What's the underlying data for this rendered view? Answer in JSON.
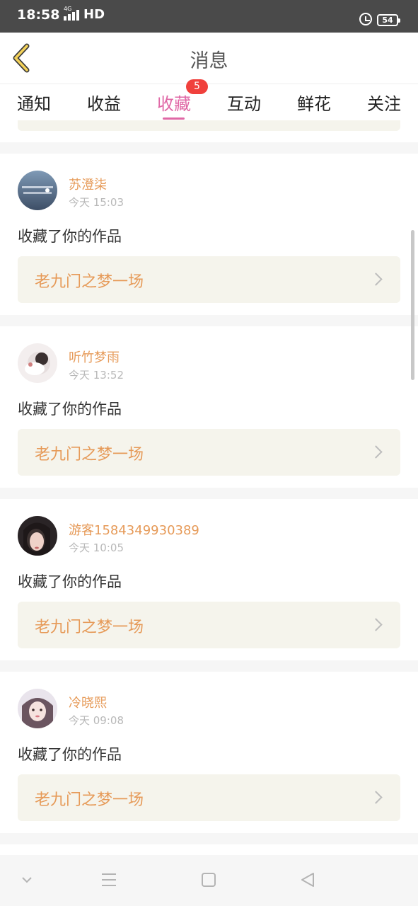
{
  "status_bar": {
    "time": "18:58",
    "network": "4G",
    "hd": "HD",
    "battery": "54"
  },
  "header": {
    "title": "消息",
    "back_icon": "chevron-left-icon"
  },
  "tabs": {
    "items": [
      {
        "label": "通知"
      },
      {
        "label": "收益"
      },
      {
        "label": "收藏",
        "active": true
      },
      {
        "label": "互动"
      },
      {
        "label": "鲜花"
      },
      {
        "label": "关注"
      }
    ],
    "badge": "5",
    "active_color": "#e068a6",
    "badge_color": "#f0403c"
  },
  "feed": {
    "items": [
      {
        "username": "苏澄柒",
        "time": "今天 15:03",
        "action": "收藏了你的作品",
        "work_title": "老九门之梦一场"
      },
      {
        "username": "听竹梦雨",
        "time": "今天 13:52",
        "action": "收藏了你的作品",
        "work_title": "老九门之梦一场"
      },
      {
        "username": "游客1584349930389",
        "time": "今天 10:05",
        "action": "收藏了你的作品",
        "work_title": "老九门之梦一场"
      },
      {
        "username": "冷晓熙",
        "time": "今天 09:08",
        "action": "收藏了你的作品",
        "work_title": "老九门之梦一场"
      }
    ],
    "accent_color": "#e69a58"
  },
  "nav_bar": {
    "icons": [
      "chevron-down-icon",
      "menu-icon",
      "home-square-icon",
      "back-triangle-icon"
    ]
  }
}
